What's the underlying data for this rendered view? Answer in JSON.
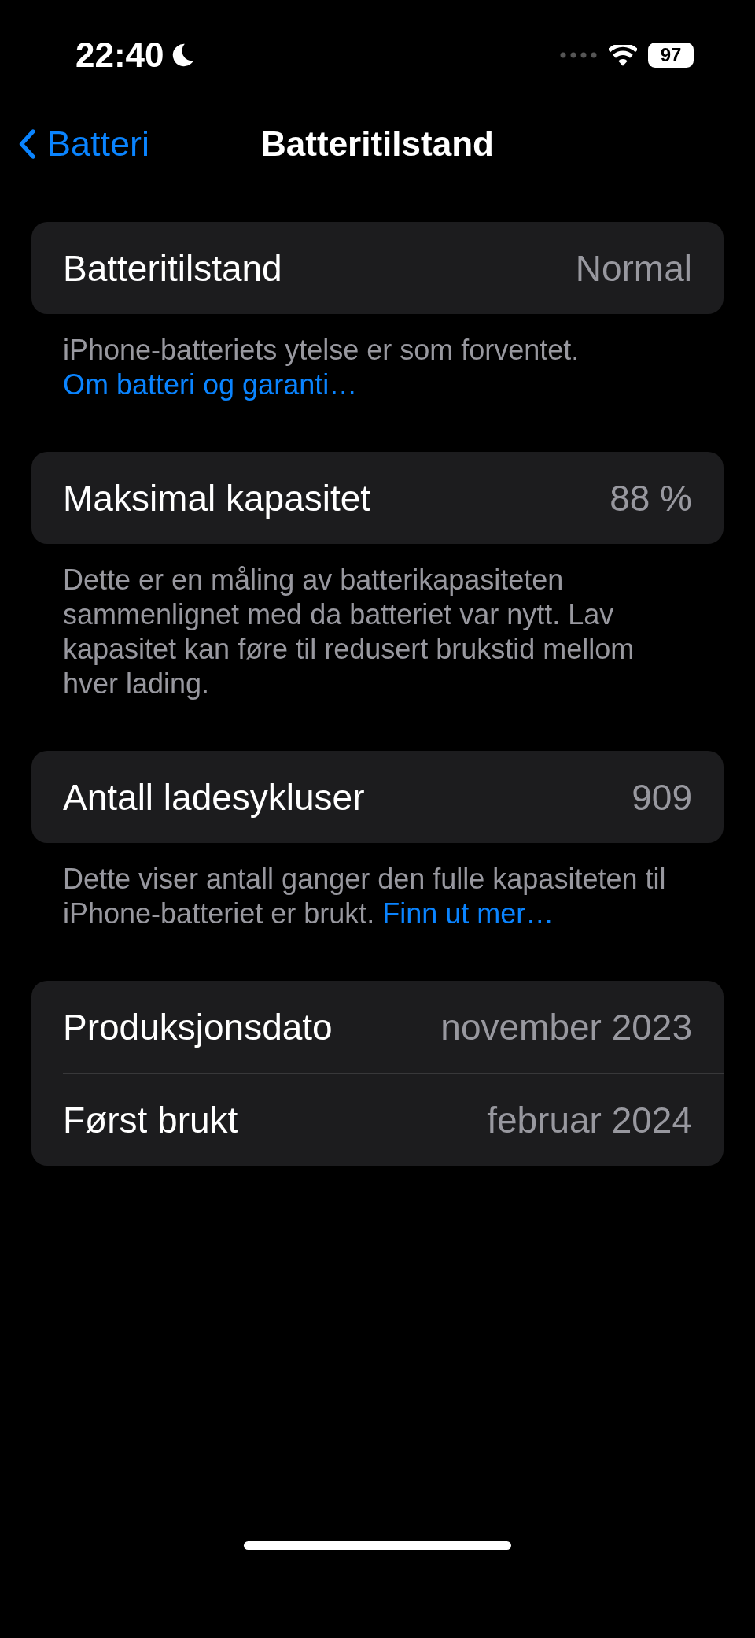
{
  "status_bar": {
    "time": "22:40",
    "battery": "97"
  },
  "nav": {
    "back": "Batteri",
    "title": "Batteritilstand"
  },
  "sections": [
    {
      "rows": [
        {
          "label": "Batteritilstand",
          "value": "Normal"
        }
      ],
      "footer": {
        "text": "iPhone-batteriets ytelse er som forventet.",
        "link": "Om batteri og garanti…"
      }
    },
    {
      "rows": [
        {
          "label": "Maksimal kapasitet",
          "value": "88 %"
        }
      ],
      "footer": {
        "text": "Dette er en måling av batterikapasiteten sammenlignet med da batteriet var nytt. Lav kapasitet kan føre til redusert brukstid mellom hver lading."
      }
    },
    {
      "rows": [
        {
          "label": "Antall ladesykluser",
          "value": "909"
        }
      ],
      "footer": {
        "text": "Dette viser antall ganger den fulle kapasiteten til iPhone-batteriet er brukt.",
        "link": "Finn ut mer…"
      }
    },
    {
      "rows": [
        {
          "label": "Produksjonsdato",
          "value": "november 2023"
        },
        {
          "label": "Først brukt",
          "value": "februar 2024"
        }
      ]
    }
  ]
}
